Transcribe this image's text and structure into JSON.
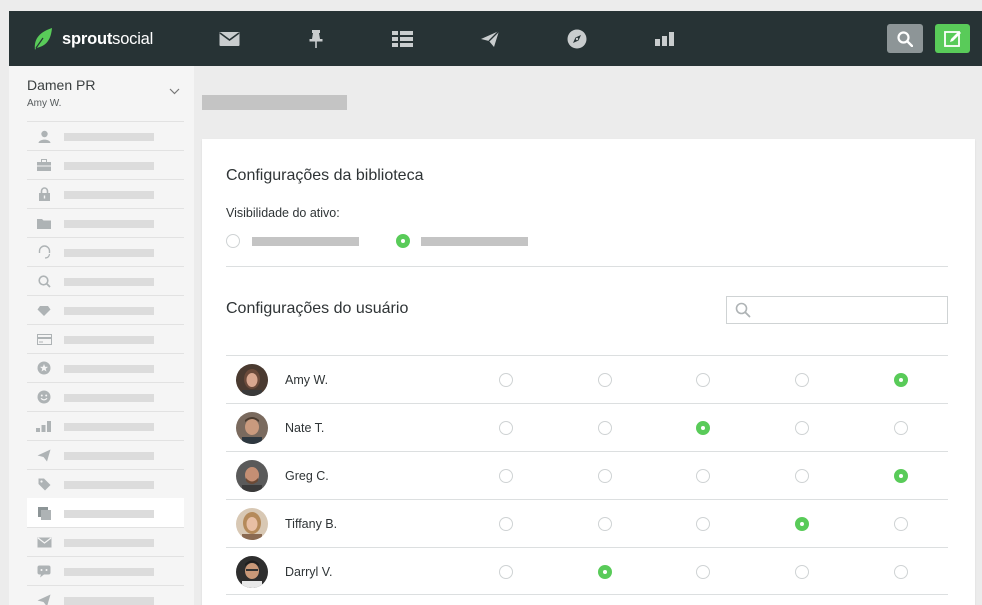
{
  "brand": {
    "name_bold": "sprout",
    "name_light": "social",
    "accent_color": "#59cb59",
    "topbar_color": "#273335"
  },
  "nav_icons": [
    "messages-icon",
    "pin-icon",
    "tasks-list-icon",
    "publish-send-icon",
    "discovery-compass-icon",
    "reports-bar-chart-icon"
  ],
  "topbar_actions": [
    "search-icon",
    "compose-icon"
  ],
  "account": {
    "name": "Damen PR",
    "user": "Amy W."
  },
  "sidebar_icons": [
    "person-icon",
    "briefcase-icon",
    "lock-icon",
    "folder-icon",
    "headset-icon",
    "magnify-icon",
    "heart-icon",
    "credit-card-icon",
    "star-badge-icon",
    "smiley-icon",
    "bar-chart-icon",
    "send-icon",
    "tag-icon",
    "asset-library-icon",
    "envelope-icon",
    "chat-bubble-icon",
    "paper-plane-icon"
  ],
  "library_settings": {
    "title": "Configurações da biblioteca",
    "visibility_label": "Visibilidade do ativo:",
    "selected_option": 2
  },
  "user_settings": {
    "title": "Configurações do usuário",
    "search_placeholder": "",
    "users": [
      {
        "name": "Amy W.",
        "selected_column": 5
      },
      {
        "name": "Nate T.",
        "selected_column": 3
      },
      {
        "name": "Greg C.",
        "selected_column": 5
      },
      {
        "name": "Tiffany B.",
        "selected_column": 4
      },
      {
        "name": "Darryl V.",
        "selected_column": 2
      }
    ]
  }
}
